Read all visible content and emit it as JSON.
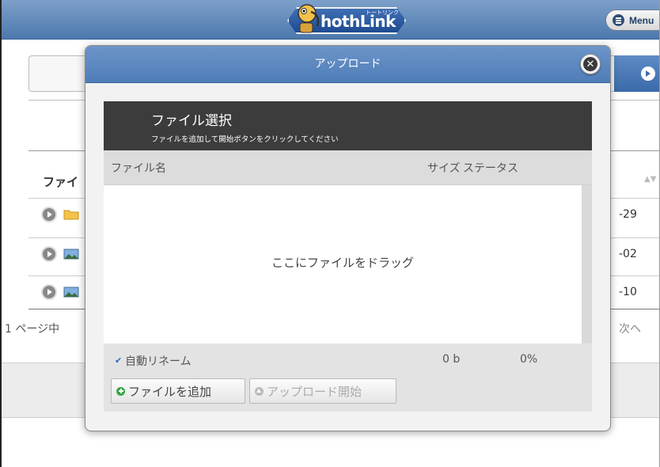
{
  "header": {
    "logo_text": "hothLink",
    "logo_subtext": "トートリンク",
    "menu_label": "Menu"
  },
  "background": {
    "table_header": "ファイ",
    "rows": [
      {
        "icon": "folder-icon",
        "date": "-29"
      },
      {
        "icon": "image-file-icon",
        "date": "-02"
      },
      {
        "icon": "image-file-icon",
        "date": "-10"
      }
    ],
    "pager_text": "1 ページ中",
    "next_label": "次へ"
  },
  "modal": {
    "title": "アップロード",
    "close_icon": "close-icon",
    "uploader": {
      "heading": "ファイル選択",
      "subheading": "ファイルを追加して開始ボタンをクリックしてください",
      "columns": {
        "filename": "ファイル名",
        "size": "サイズ",
        "status": "ステータス"
      },
      "dropzone_text": "ここにファイルをドラッグ",
      "auto_rename_label": "自動リネーム",
      "auto_rename_checked": true,
      "total_size": "0 b",
      "total_percent": "0%",
      "add_button": "ファイルを追加",
      "start_button": "アップロード開始"
    }
  },
  "colors": {
    "header_blue": "#5a84bb",
    "title_bar_dark": "#3c3c3c",
    "add_icon_green": "#3aa548"
  }
}
